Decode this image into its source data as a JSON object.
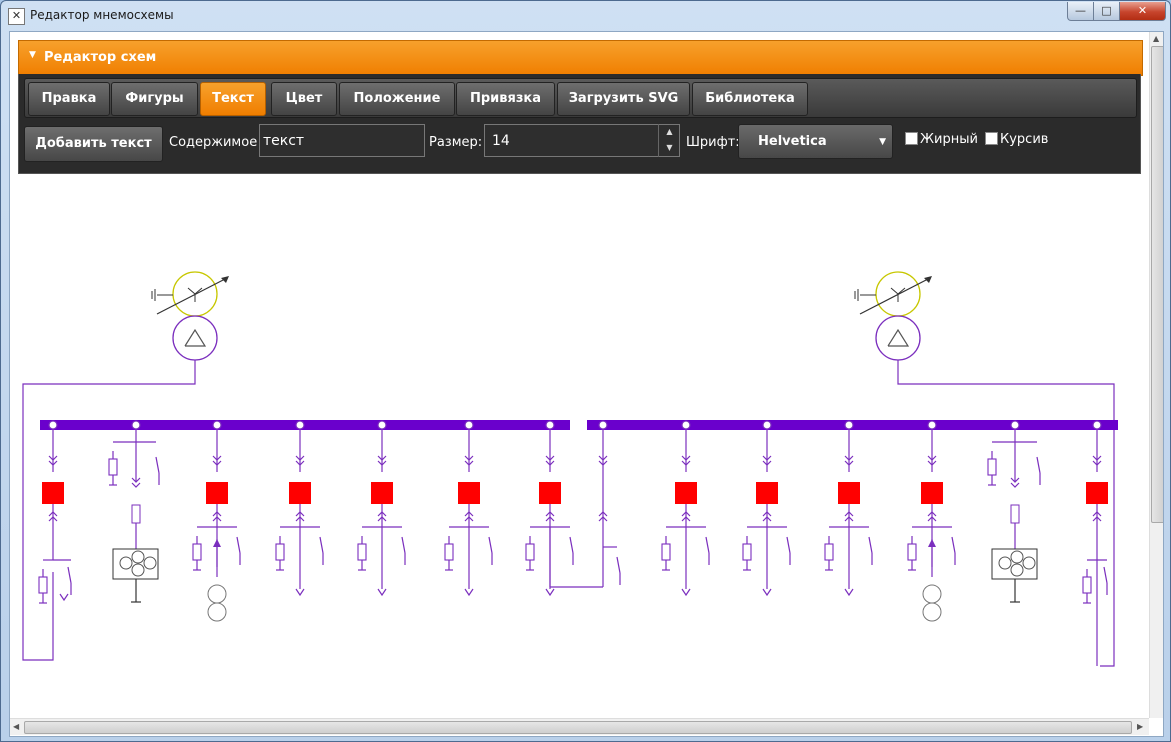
{
  "window": {
    "title": "Редактор мнемосхемы",
    "app_icon": "wrench-icon",
    "buttons": {
      "minimize": "—",
      "maximize": "□",
      "close": "✕"
    }
  },
  "panel": {
    "header": "Редактор схем"
  },
  "tabs": [
    {
      "label": "Правка"
    },
    {
      "label": "Фигуры"
    },
    {
      "label": "Текст",
      "active": true
    },
    {
      "label": "Цвет"
    },
    {
      "label": "Положение"
    },
    {
      "label": "Привязка"
    },
    {
      "label": "Загрузить SVG"
    },
    {
      "label": "Библиотека"
    }
  ],
  "toolbar": {
    "add_text_label": "Добавить текст",
    "content_label": "Содержимое",
    "content_value": "текст",
    "size_label": "Размер:",
    "size_value": "14",
    "font_label": "Шрифт:",
    "font_value": "Helvetica",
    "bold_label": "Жирный",
    "bold_checked": false,
    "italic_label": "Курсив",
    "italic_checked": false
  },
  "colors": {
    "accent": "#f08000",
    "bus": "#6a00cc",
    "wire": "#7b2fbe",
    "breaker": "#ff0000",
    "transformer_ring": "#c7c700"
  }
}
